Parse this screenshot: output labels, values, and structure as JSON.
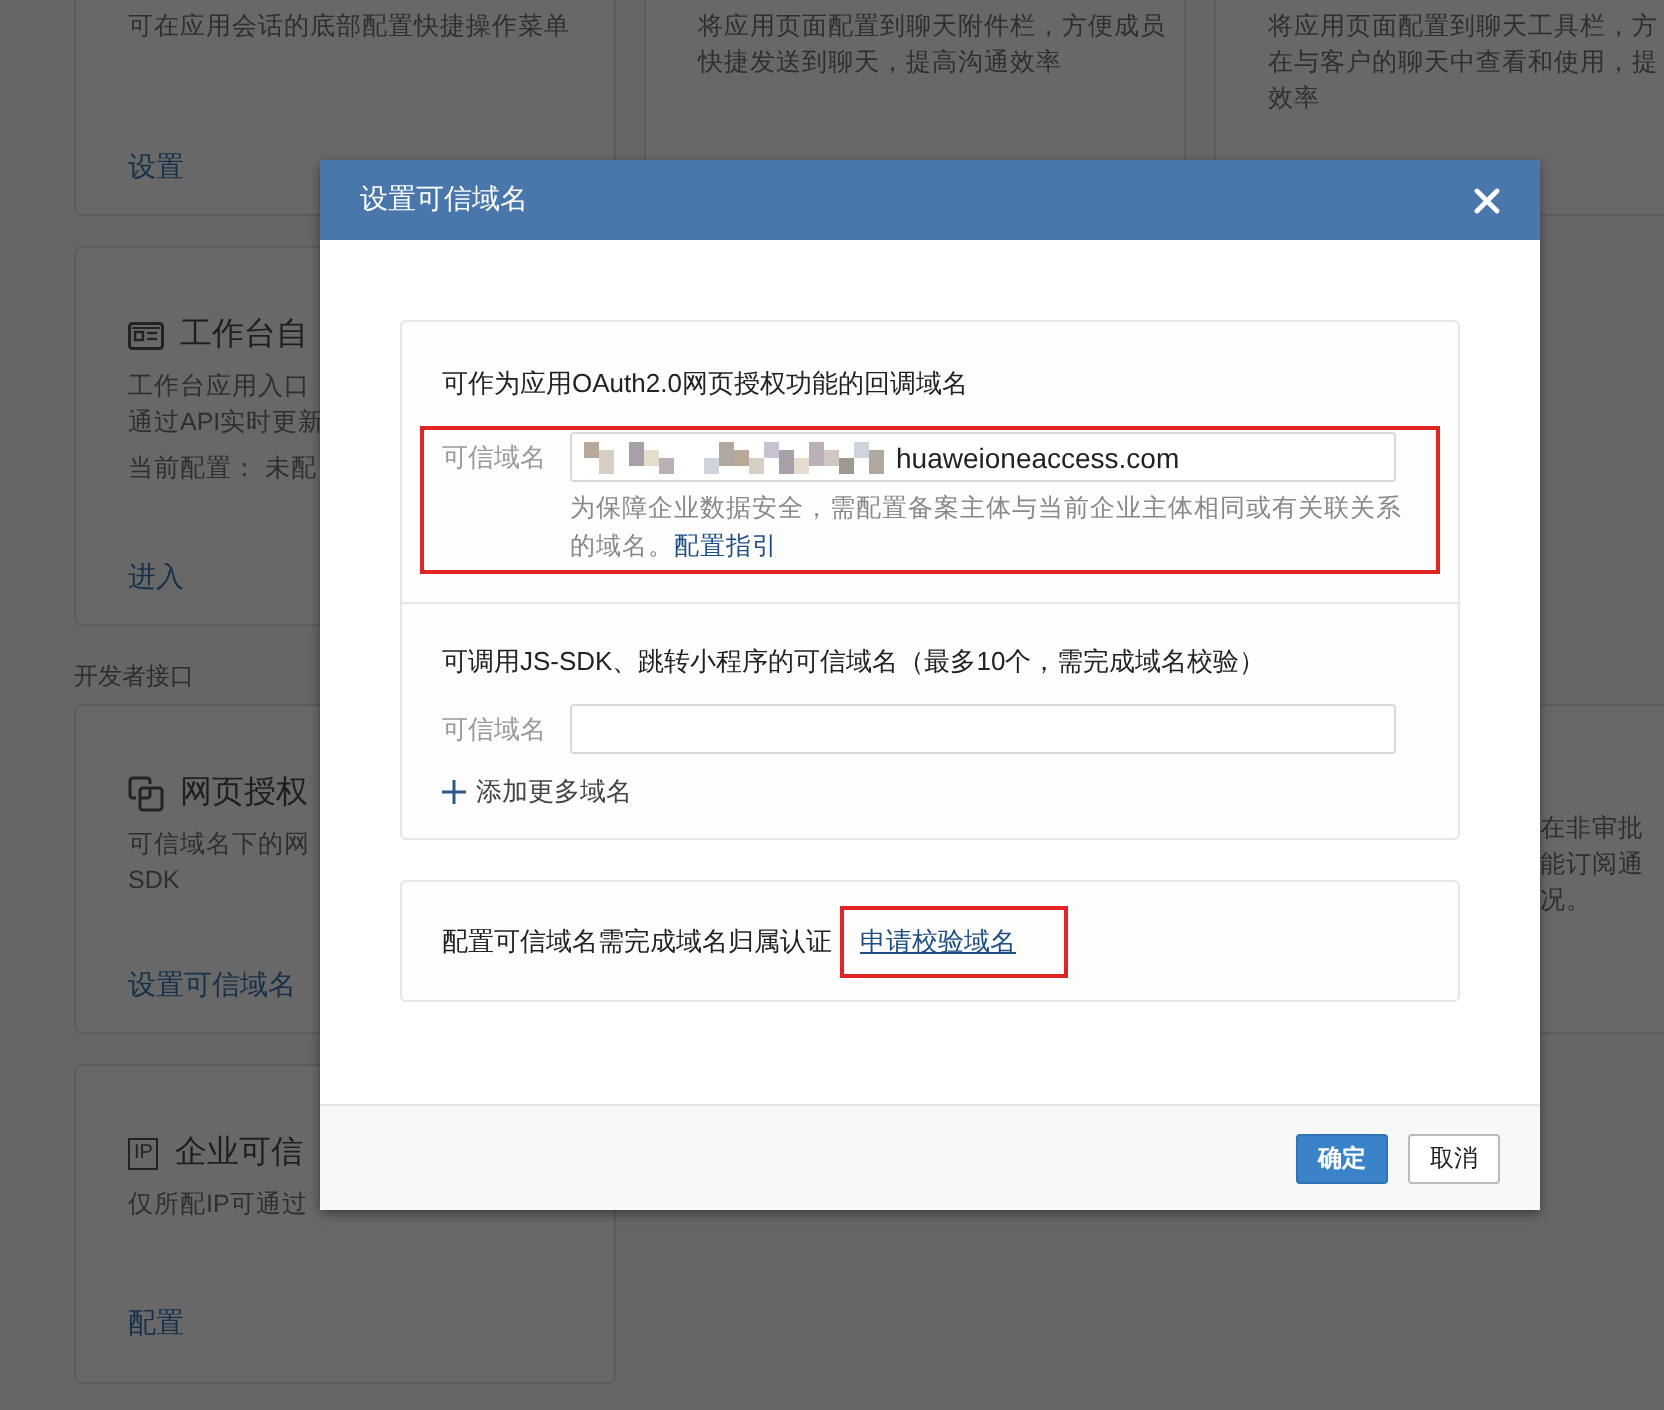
{
  "background": {
    "rows": [
      {
        "cards": [
          {
            "kind": "plain",
            "description": [
              "可在应用会话的底部配置快捷操作菜单"
            ],
            "action": "设置"
          },
          {
            "kind": "plain",
            "description": [
              "将应用页面配置到聊天附件栏，方便成员",
              "快捷发送到聊天，提高沟通效率"
            ]
          },
          {
            "kind": "plain",
            "description": [
              "将应用页面配置到聊天工具栏，方",
              "在与客户的聊天中查看和使用，提",
              "效率"
            ]
          }
        ]
      },
      {
        "cards": [
          {
            "kind": "workbench",
            "title": "工作台自",
            "description": [
              "工作台应用入口",
              "通过API实时更新"
            ],
            "info": "当前配置： 未配",
            "action": "进入"
          }
        ]
      },
      {
        "section_label": "开发者接口",
        "cards": [
          {
            "kind": "webauth",
            "title": "网页授权",
            "description": [
              "可信域名下的网",
              "SDK"
            ],
            "action": "设置可信域名"
          },
          {
            "kind": "hidden"
          },
          {
            "kind": "partial",
            "description": [
              "在非审批",
              "能订阅通",
              "况。"
            ]
          }
        ]
      },
      {
        "cards": [
          {
            "kind": "ip",
            "badge": "IP",
            "title": "企业可信",
            "description": [
              "仅所配IP可通过"
            ],
            "action": "配置"
          }
        ]
      }
    ]
  },
  "dialog": {
    "title": "设置可信域名",
    "oauth_section": {
      "heading": "可作为应用OAuth2.0网页授权功能的回调域名",
      "label": "可信域名",
      "value": "huaweioneaccess.com",
      "redacted": true,
      "hint": "为保障企业数据安全，需配置备案主体与当前企业主体相同或有关联关系的域名。",
      "hint_link": "配置指引",
      "highlighted": true
    },
    "jssdk_section": {
      "heading": "可调用JS-SDK、跳转小程序的可信域名（最多10个，需完成域名校验）",
      "label": "可信域名",
      "add_link": "添加更多域名"
    },
    "verify_section": {
      "text": "配置可信域名需完成域名归属认证",
      "link": "申请校验域名",
      "highlighted": true
    },
    "buttons": [
      {
        "label": "确定",
        "kind": "primary"
      },
      {
        "label": "取消",
        "kind": "default"
      }
    ]
  }
}
